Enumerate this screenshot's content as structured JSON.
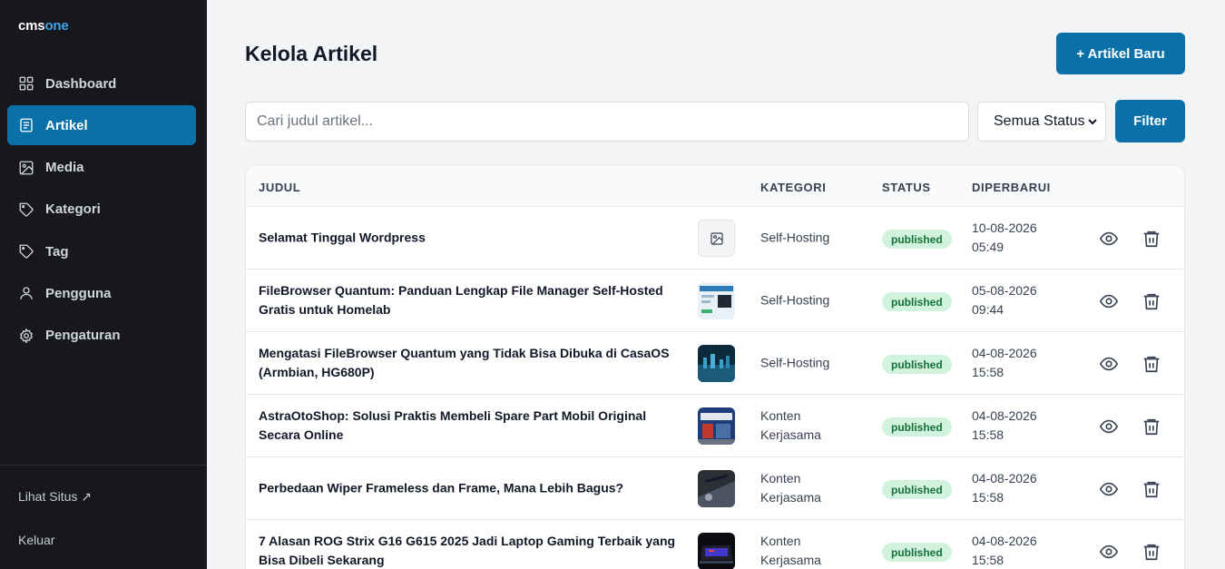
{
  "brand": {
    "part1": "cms",
    "part2": "one"
  },
  "sidebar": {
    "items": [
      {
        "label": "Dashboard",
        "icon": "grid-icon",
        "active": false
      },
      {
        "label": "Artikel",
        "icon": "document-icon",
        "active": true
      },
      {
        "label": "Media",
        "icon": "image-icon",
        "active": false
      },
      {
        "label": "Kategori",
        "icon": "tag-icon",
        "active": false
      },
      {
        "label": "Tag",
        "icon": "tag-icon",
        "active": false
      },
      {
        "label": "Pengguna",
        "icon": "user-icon",
        "active": false
      },
      {
        "label": "Pengaturan",
        "icon": "gear-icon",
        "active": false
      }
    ],
    "view_site": "Lihat Situs ↗",
    "logout": "Keluar"
  },
  "header": {
    "title": "Kelola Artikel",
    "new_button": "+ Artikel Baru"
  },
  "filters": {
    "search_placeholder": "Cari judul artikel...",
    "status_selected": "Semua Status",
    "filter_button": "Filter"
  },
  "table": {
    "columns": {
      "title": "JUDUL",
      "category": "KATEGORI",
      "status": "STATUS",
      "updated": "DIPERBARUI"
    },
    "rows": [
      {
        "title": "Selamat Tinggal Wordpress",
        "category": "Self-Hosting",
        "status": "published",
        "date": "10-08-2026",
        "time": "05:49",
        "thumb": "none"
      },
      {
        "title": "FileBrowser Quantum: Panduan Lengkap File Manager Self-Hosted Gratis untuk Homelab",
        "category": "Self-Hosting",
        "status": "published",
        "date": "05-08-2026",
        "time": "09:44",
        "thumb": "screenshot"
      },
      {
        "title": "Mengatasi FileBrowser Quantum yang Tidak Bisa Dibuka di CasaOS (Armbian, HG680P)",
        "category": "Self-Hosting",
        "status": "published",
        "date": "04-08-2026",
        "time": "15:58",
        "thumb": "night-city"
      },
      {
        "title": "AstraOtoShop: Solusi Praktis Membeli Spare Part Mobil Original Secara Online",
        "category": "Konten Kerjasama",
        "status": "published",
        "date": "04-08-2026",
        "time": "15:58",
        "thumb": "shop"
      },
      {
        "title": "Perbedaan Wiper Frameless dan Frame, Mana Lebih Bagus?",
        "category": "Konten Kerjasama",
        "status": "published",
        "date": "04-08-2026",
        "time": "15:58",
        "thumb": "car-wiper"
      },
      {
        "title": "7 Alasan ROG Strix G16 G615 2025 Jadi Laptop Gaming Terbaik yang Bisa Dibeli Sekarang",
        "category": "Konten Kerjasama",
        "status": "published",
        "date": "04-08-2026",
        "time": "15:58",
        "thumb": "laptop"
      }
    ]
  },
  "colors": {
    "accent": "#0a70a8",
    "sidebar_bg": "#16181d",
    "badge_bg": "#d1f2dc",
    "badge_text": "#15703a"
  }
}
